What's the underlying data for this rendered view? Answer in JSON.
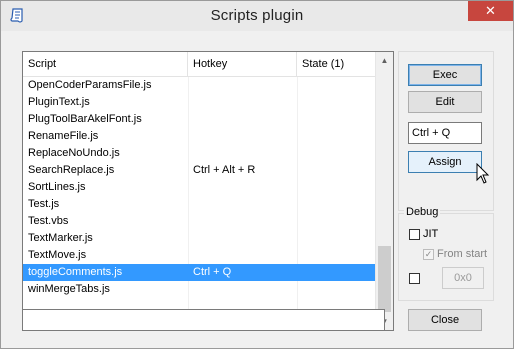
{
  "window": {
    "title": "Scripts plugin",
    "icon": "script-scroll-icon",
    "close_glyph": "✕"
  },
  "list": {
    "columns": [
      "Script",
      "Hotkey",
      "State (1)"
    ],
    "rows": [
      {
        "script": "OpenCoderParamsFile.js",
        "hotkey": "",
        "state": "",
        "selected": false
      },
      {
        "script": "PluginText.js",
        "hotkey": "",
        "state": "",
        "selected": false
      },
      {
        "script": "PlugToolBarAkelFont.js",
        "hotkey": "",
        "state": "",
        "selected": false
      },
      {
        "script": "RenameFile.js",
        "hotkey": "",
        "state": "",
        "selected": false
      },
      {
        "script": "ReplaceNoUndo.js",
        "hotkey": "",
        "state": "",
        "selected": false
      },
      {
        "script": "SearchReplace.js",
        "hotkey": "Ctrl + Alt + R",
        "state": "",
        "selected": false
      },
      {
        "script": "SortLines.js",
        "hotkey": "",
        "state": "",
        "selected": false
      },
      {
        "script": "Test.js",
        "hotkey": "",
        "state": "",
        "selected": false
      },
      {
        "script": "Test.vbs",
        "hotkey": "",
        "state": "",
        "selected": false
      },
      {
        "script": "TextMarker.js",
        "hotkey": "",
        "state": "",
        "selected": false
      },
      {
        "script": "TextMove.js",
        "hotkey": "",
        "state": "",
        "selected": false
      },
      {
        "script": "toggleComments.js",
        "hotkey": "Ctrl + Q",
        "state": "",
        "selected": true
      },
      {
        "script": "winMergeTabs.js",
        "hotkey": "",
        "state": "",
        "selected": false
      }
    ],
    "scroll_up": "▲",
    "scroll_down": "▼"
  },
  "actions": {
    "exec_label": "Exec",
    "edit_label": "Edit",
    "hotkey_value": "Ctrl + Q",
    "assign_label": "Assign"
  },
  "debug": {
    "label": "Debug",
    "jit_label": "JIT",
    "jit_checked": false,
    "from_start_label": "From start",
    "from_start_checked": true,
    "from_start_check_glyph": "✓",
    "value_checked": false,
    "value_field": "0x0"
  },
  "status": {
    "value": ""
  },
  "footer": {
    "close_label": "Close"
  },
  "colors": {
    "selection": "#3399ff",
    "close_button": "#c7463e",
    "default_button_border": "#3c7fb1"
  }
}
